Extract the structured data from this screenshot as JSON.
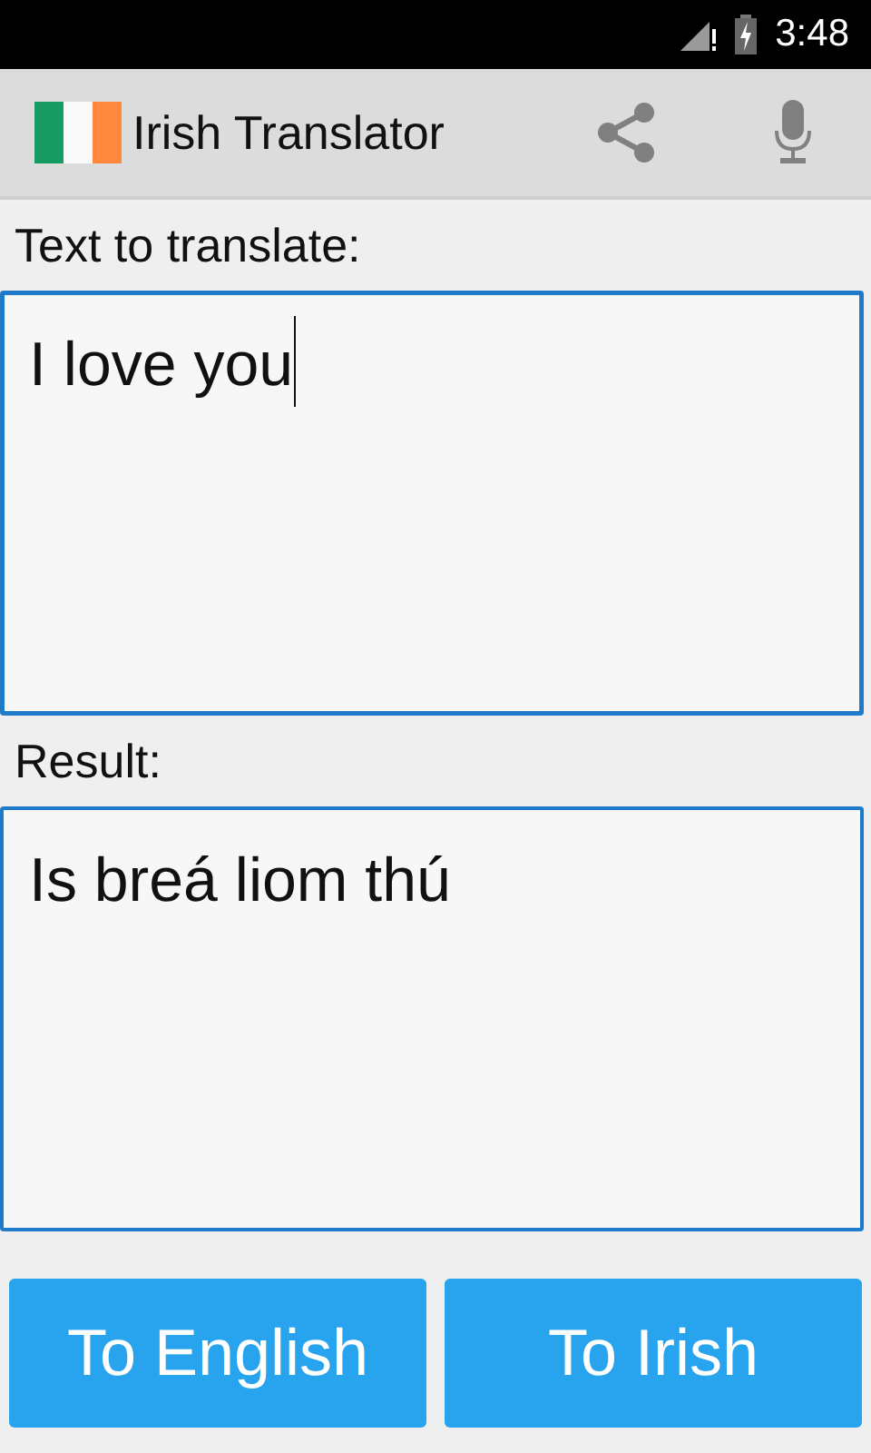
{
  "status_bar": {
    "time": "3:48"
  },
  "action_bar": {
    "title": "Irish Translator"
  },
  "input": {
    "label": "Text to translate:",
    "value": "I love you",
    "focused": true
  },
  "result": {
    "label": "Result:",
    "value": "Is breá liom thú"
  },
  "buttons": [
    {
      "label": "To English"
    },
    {
      "label": "To Irish"
    }
  ]
}
